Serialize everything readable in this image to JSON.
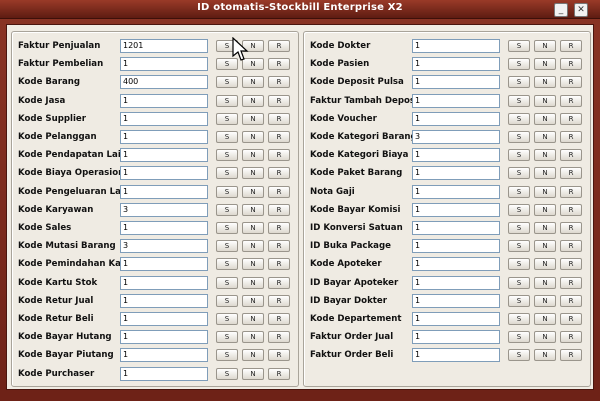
{
  "window": {
    "title": "ID otomatis-Stockbill Enterprise X2",
    "minimize_glyph": "_",
    "close_glyph": "✕"
  },
  "buttons": {
    "s": "S",
    "n": "N",
    "r": "R"
  },
  "left_rows": [
    {
      "label": "Faktur Penjualan",
      "value": "1201"
    },
    {
      "label": "Faktur Pembelian",
      "value": "1"
    },
    {
      "label": "Kode Barang",
      "value": "400"
    },
    {
      "label": "Kode Jasa",
      "value": "1"
    },
    {
      "label": "Kode Supplier",
      "value": "1"
    },
    {
      "label": "Kode Pelanggan",
      "value": "1"
    },
    {
      "label": "Kode Pendapatan Lain",
      "value": "1"
    },
    {
      "label": "Kode Biaya Operasional",
      "value": "1"
    },
    {
      "label": "Kode Pengeluaran Lain",
      "value": "1"
    },
    {
      "label": "Kode Karyawan",
      "value": "3"
    },
    {
      "label": "Kode Sales",
      "value": "1"
    },
    {
      "label": "Kode Mutasi Barang",
      "value": "3"
    },
    {
      "label": "Kode Pemindahan Kas",
      "value": "1"
    },
    {
      "label": "Kode Kartu Stok",
      "value": "1"
    },
    {
      "label": "Kode Retur Jual",
      "value": "1"
    },
    {
      "label": "Kode Retur Beli",
      "value": "1"
    },
    {
      "label": "Kode Bayar Hutang",
      "value": "1"
    },
    {
      "label": "Kode Bayar Piutang",
      "value": "1"
    },
    {
      "label": "Kode Purchaser",
      "value": "1"
    }
  ],
  "right_rows": [
    {
      "label": "Kode Dokter",
      "value": "1"
    },
    {
      "label": "Kode Pasien",
      "value": "1"
    },
    {
      "label": "Kode Deposit Pulsa",
      "value": "1"
    },
    {
      "label": "Faktur Tambah Deposit",
      "value": "1"
    },
    {
      "label": "Kode Voucher",
      "value": "1"
    },
    {
      "label": "Kode Kategori Barang",
      "value": "3"
    },
    {
      "label": "Kode Kategori Biaya",
      "value": "1"
    },
    {
      "label": "Kode Paket Barang",
      "value": "1"
    },
    {
      "label": "Nota Gaji",
      "value": "1"
    },
    {
      "label": "Kode Bayar Komisi",
      "value": "1"
    },
    {
      "label": "ID Konversi Satuan",
      "value": "1"
    },
    {
      "label": "ID Buka Package",
      "value": "1"
    },
    {
      "label": "Kode Apoteker",
      "value": "1"
    },
    {
      "label": "ID Bayar Apoteker",
      "value": "1"
    },
    {
      "label": "ID Bayar Dokter",
      "value": "1"
    },
    {
      "label": "Kode Departement",
      "value": "1"
    },
    {
      "label": "Faktur Order Jual",
      "value": "1"
    },
    {
      "label": "Faktur Order Beli",
      "value": "1"
    }
  ]
}
